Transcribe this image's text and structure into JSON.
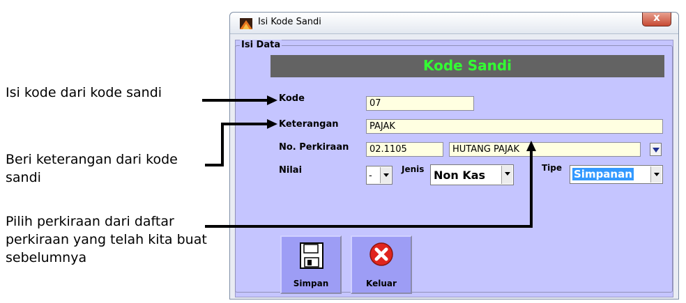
{
  "annotations": [
    "Isi kode dari kode sandi",
    "Beri keterangan dari kode sandi",
    "Pilih perkiraan dari daftar perkiraan yang telah kita buat sebelumnya"
  ],
  "window": {
    "title": "Isi Kode Sandi",
    "close_label": "x"
  },
  "group_title": "Isi Data",
  "banner": "Kode Sandi",
  "form": {
    "kode_label": "Kode",
    "kode_value": "07",
    "keterangan_label": "Keterangan",
    "keterangan_value": "PAJAK",
    "perkiraan_label": "No. Perkiraan",
    "perkiraan_code": "02.1105",
    "perkiraan_name": "HUTANG PAJAK",
    "nilai_label": "Nilai",
    "nilai_value": "-",
    "jenis_label": "Jenis",
    "jenis_value": "Non Kas",
    "tipe_label": "Tipe",
    "tipe_value": "Simpanan"
  },
  "buttons": {
    "simpan": "Simpan",
    "keluar": "Keluar"
  },
  "colors": {
    "panel_bg": "#c5c5ff",
    "banner_bg": "#636363",
    "banner_text": "#33ff33",
    "field_bg": "#ffffe1",
    "selected_bg": "#3399ff"
  },
  "icons": [
    "floppy-disk-icon",
    "close-circle-icon",
    "arrow-icon"
  ]
}
